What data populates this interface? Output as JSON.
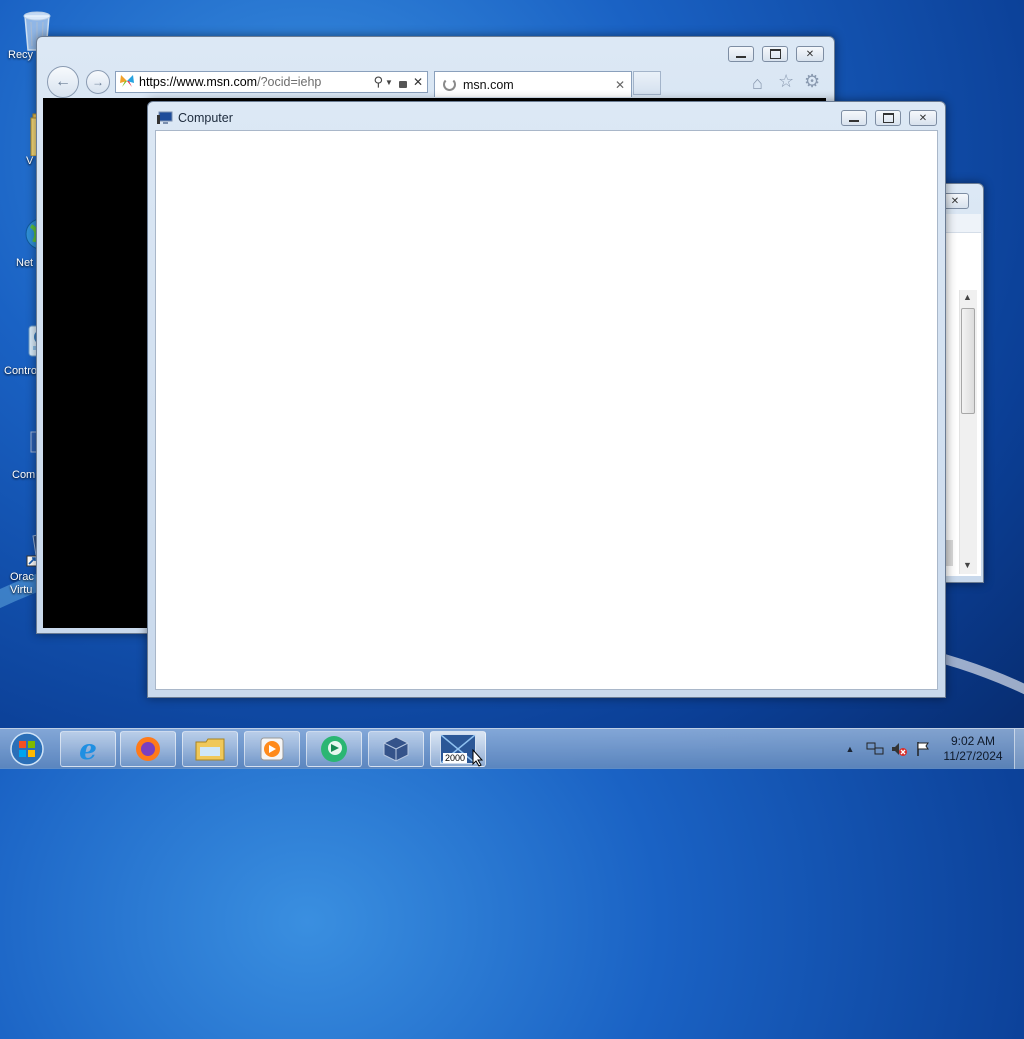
{
  "desktop": {
    "icons": [
      {
        "name": "recycle-bin",
        "label": "Recy"
      },
      {
        "name": "folder",
        "label": "V"
      },
      {
        "name": "network",
        "label": "Net"
      },
      {
        "name": "control-panel",
        "label": "Contro"
      },
      {
        "name": "computer",
        "label": "Com"
      },
      {
        "name": "oracle-virtualbox",
        "label": "Orac\nVirtu"
      }
    ]
  },
  "ie_window": {
    "url_prefix": "https://www.",
    "url_host": "msn.com",
    "url_rest": "/?ocid=iehp",
    "tab_title": "msn.com",
    "tab_close": "✕",
    "addr_close": "✕"
  },
  "computer_window": {
    "title": "Computer"
  },
  "taskbar": {
    "pinned": [
      {
        "name": "internet-explorer"
      },
      {
        "name": "firefox"
      },
      {
        "name": "file-explorer"
      },
      {
        "name": "media-player"
      },
      {
        "name": "app-green"
      },
      {
        "name": "virtualbox"
      },
      {
        "name": "app-2000",
        "badge": "2000"
      }
    ],
    "clock_time": "9:02 AM",
    "clock_date": "11/27/2024"
  },
  "colors": {
    "desktop": "#1a62c4",
    "window_frame": "#dce8f5",
    "taskbar": "#8fb3dd"
  }
}
